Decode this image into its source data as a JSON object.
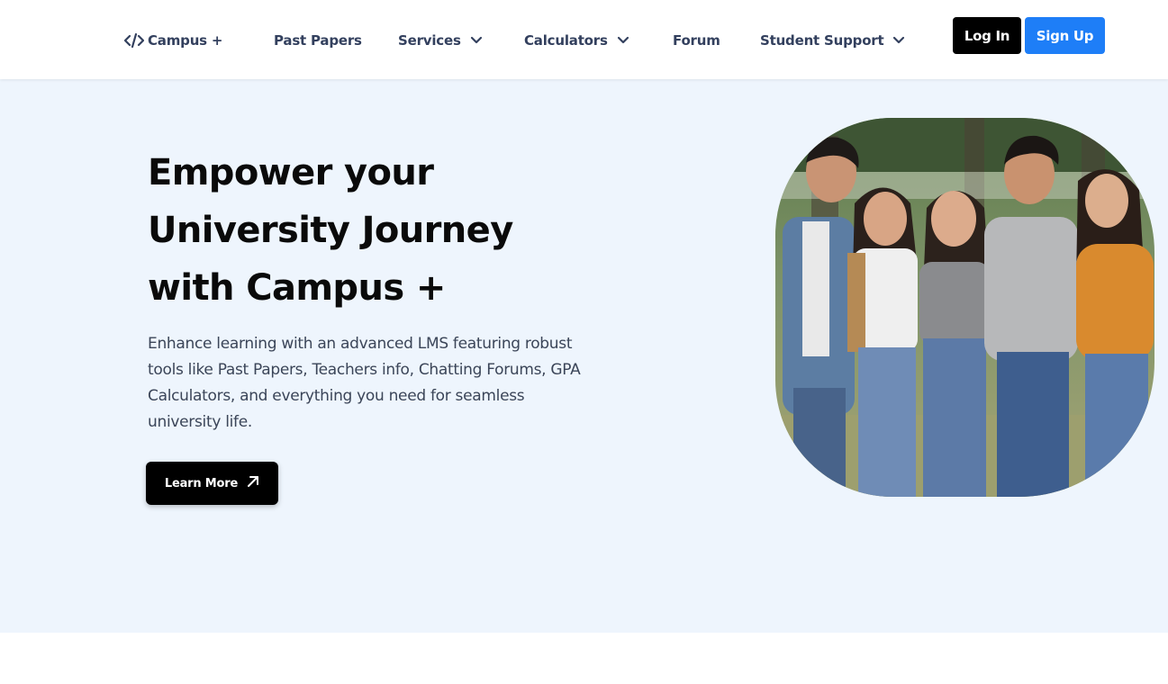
{
  "nav": {
    "logo_text": "Campus +",
    "logo_icon": "code-brackets-icon",
    "items": [
      {
        "label": "Past Papers",
        "dropdown": false
      },
      {
        "label": "Services",
        "dropdown": true
      },
      {
        "label": "Calculators",
        "dropdown": true
      },
      {
        "label": "Forum",
        "dropdown": false
      },
      {
        "label": "Student Support",
        "dropdown": true
      }
    ],
    "login_label": "Log In",
    "signup_label": "Sign Up"
  },
  "hero": {
    "title_lines": [
      "Empower your",
      "University Journey",
      "with Campus +"
    ],
    "description": "Enhance learning with an advanced LMS featuring robust tools like Past Papers, Teachers info, Chatting Forums, GPA Calculators, and everything you need for seamless university life.",
    "cta_label": "Learn More",
    "cta_icon": "arrow-up-right-icon",
    "image_subject": "group of five smiling university students"
  },
  "colors": {
    "nav_text": "#33405e",
    "login_bg": "#000000",
    "signup_bg": "#1e7ef7",
    "hero_bg": "#eef5fd",
    "title_text": "#0a0a0a",
    "desc_text": "#3b4558"
  }
}
